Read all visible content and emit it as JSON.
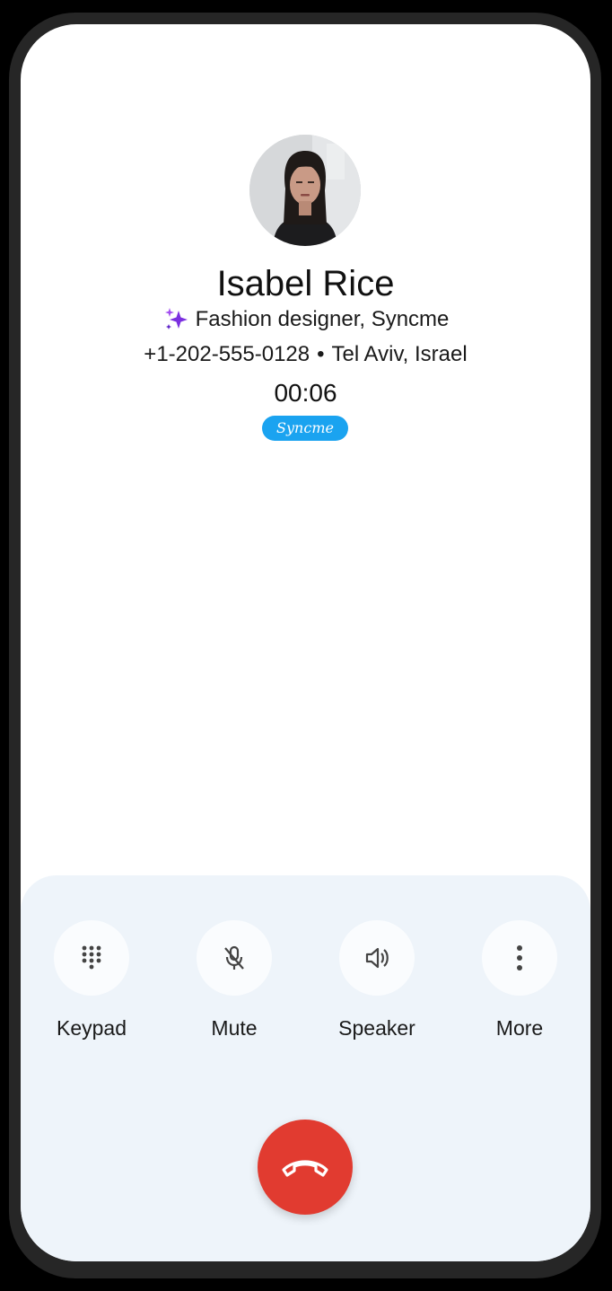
{
  "caller": {
    "name": "Isabel Rice",
    "title": "Fashion designer, Syncme",
    "phone": "+1-202-555-0128",
    "separator": "•",
    "location": "Tel Aviv, Israel",
    "duration": "00:06",
    "badge": "Syncme"
  },
  "controls": [
    {
      "label": "Keypad",
      "icon": "dialpad-icon"
    },
    {
      "label": "Mute",
      "icon": "mic-off-icon"
    },
    {
      "label": "Speaker",
      "icon": "speaker-icon"
    },
    {
      "label": "More",
      "icon": "more-vertical-icon"
    }
  ],
  "end_call": {
    "icon": "hang-up-icon"
  },
  "colors": {
    "end_call": "#e13b30",
    "badge": "#1aa3f0",
    "panel": "#eef4fa",
    "sparkle": "#7b2fe0"
  }
}
